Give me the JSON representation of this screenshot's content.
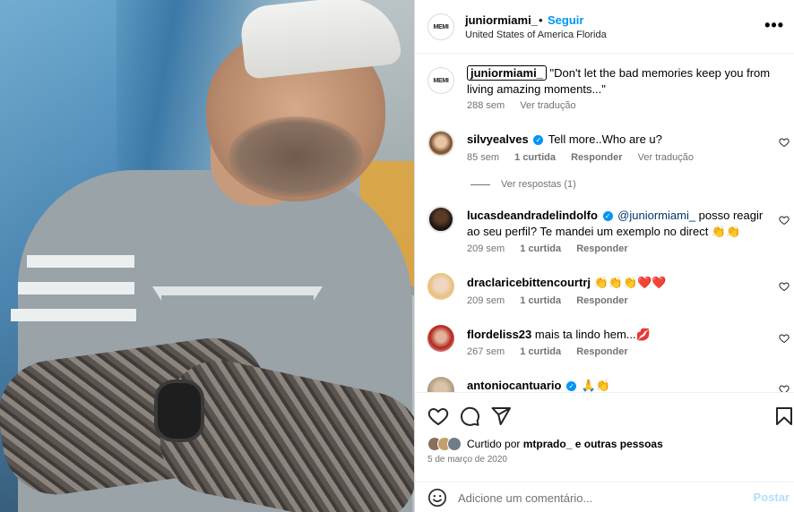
{
  "post": {
    "username": "juniormiami_",
    "dot": "•",
    "follow_label": "Seguir",
    "location": "United States of America Florida",
    "avatar_text": "MEMI",
    "more_icon": "more-icon"
  },
  "caption": {
    "username": "juniormiami_",
    "text": "\"Don't let the bad memories keep you from living amazing moments...\"",
    "time": "288 sem",
    "translate": "Ver tradução"
  },
  "comments": [
    {
      "username": "silvyealves",
      "verified": true,
      "text": "Tell more..Who are u?",
      "time": "85 sem",
      "likes": "1 curtida",
      "reply": "Responder",
      "translate": "Ver tradução",
      "replies": "Ver respostas (1)"
    },
    {
      "username": "lucasdeandradelindolfo",
      "verified": true,
      "mention": "@juniormiami_",
      "text": " posso reagir ao seu perfil? Te mandei um exemplo no direct 👏👏",
      "time": "209 sem",
      "likes": "1 curtida",
      "reply": "Responder"
    },
    {
      "username": "draclaricebittencourtrj",
      "text": "👏👏👏❤️❤️",
      "time": "209 sem",
      "likes": "1 curtida",
      "reply": "Responder"
    },
    {
      "username": "flordeliss23",
      "text": "mais ta lindo hem...💋",
      "time": "267 sem",
      "likes": "1 curtida",
      "reply": "Responder"
    },
    {
      "username": "antoniocantuario",
      "verified": true,
      "text": "🙏👏"
    }
  ],
  "likes": {
    "prefix": "Curtido por ",
    "user": "mtprado_",
    "suffix": " e outras pessoas"
  },
  "date": "5 de março de 2020",
  "add_comment": {
    "placeholder": "Adicione um comentário...",
    "post_label": "Postar"
  },
  "colors": {
    "accent": "#0095f6",
    "post_disabled": "#b2dffc",
    "muted": "#737373"
  }
}
